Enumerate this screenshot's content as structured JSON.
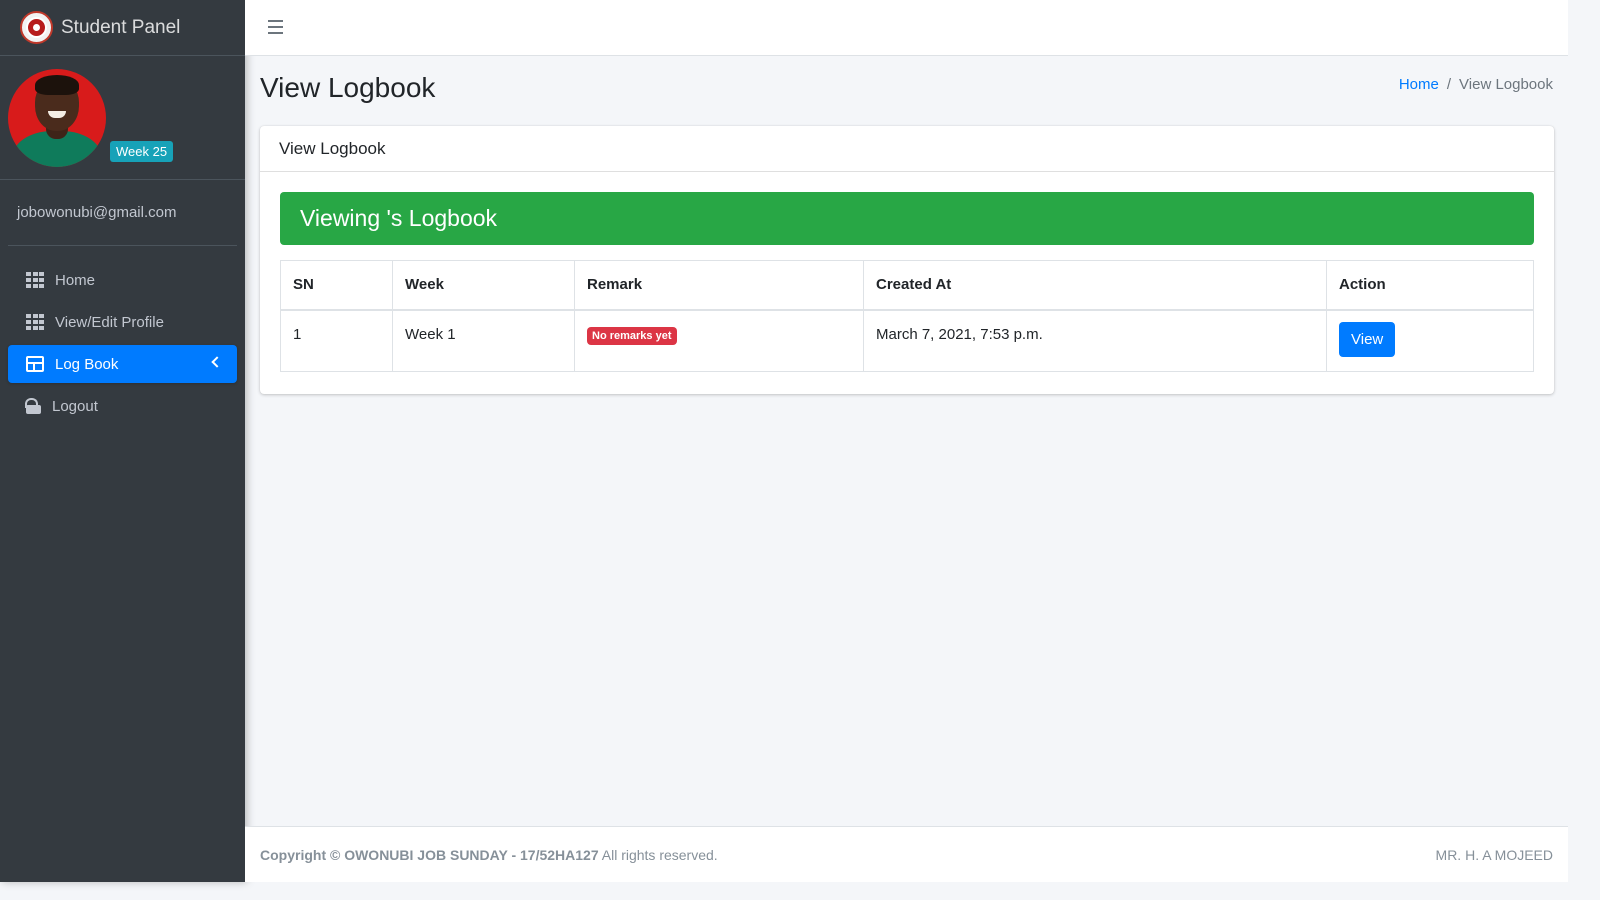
{
  "brand": {
    "title": "Student Panel"
  },
  "user": {
    "week_badge": "Week 25",
    "email": "jobowonubi@gmail.com"
  },
  "sidebar": {
    "items": [
      {
        "label": "Home",
        "icon": "grid-icon"
      },
      {
        "label": "View/Edit Profile",
        "icon": "grid-icon"
      },
      {
        "label": "Log Book",
        "icon": "table-icon",
        "active": true
      },
      {
        "label": "Logout",
        "icon": "lock-icon"
      }
    ]
  },
  "header": {
    "page_title": "View Logbook",
    "breadcrumb": {
      "home": "Home",
      "separator": "/",
      "current": "View Logbook"
    }
  },
  "card": {
    "title": "View Logbook",
    "alert": "Viewing 's Logbook",
    "table": {
      "columns": [
        "SN",
        "Week",
        "Remark",
        "Created At",
        "Action"
      ],
      "rows": [
        {
          "sn": "1",
          "week": "Week 1",
          "remark": "No remarks yet",
          "created_at": "March 7, 2021, 7:53 p.m.",
          "action": "View"
        }
      ]
    }
  },
  "footer": {
    "copyright": "Copyright © OWONUBI JOB SUNDAY - 17/52HA127",
    "rights": " All rights reserved.",
    "right_text": "MR. H. A MOJEED"
  },
  "colors": {
    "sidebar": "#343a40",
    "primary": "#007bff",
    "success": "#28a745",
    "danger": "#dc3545",
    "info": "#17a2b8"
  }
}
